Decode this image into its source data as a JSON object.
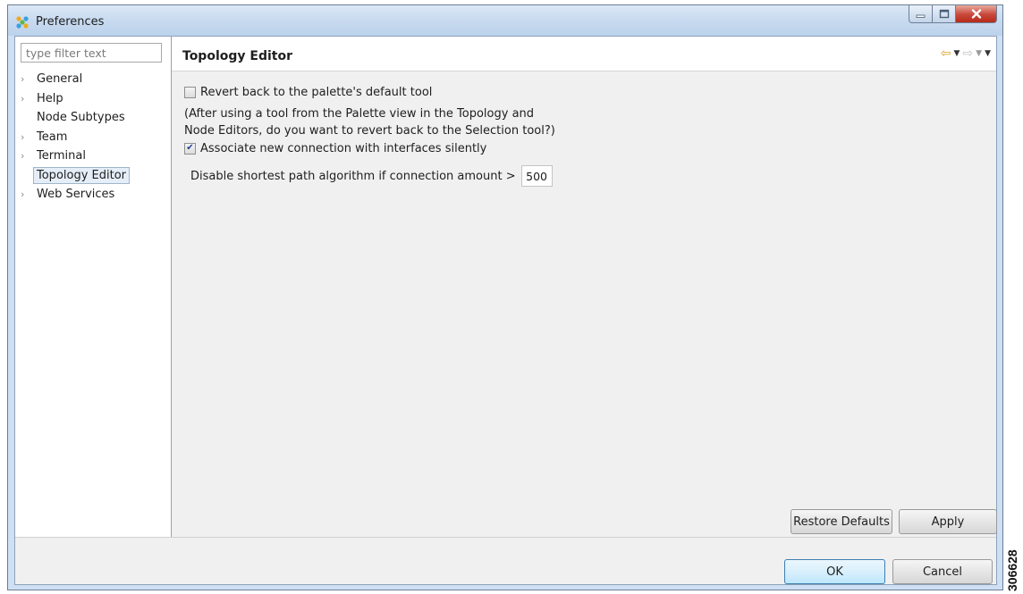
{
  "window": {
    "title": "Preferences",
    "icon": "eclipse-preferences-icon",
    "controls": [
      "minimize-icon",
      "maximize-icon",
      "close-icon"
    ]
  },
  "filter": {
    "placeholder": "type filter text",
    "value": ""
  },
  "tree": {
    "items": [
      {
        "label": "General",
        "expandable": true,
        "selected": false
      },
      {
        "label": "Help",
        "expandable": true,
        "selected": false
      },
      {
        "label": "Node Subtypes",
        "expandable": false,
        "selected": false
      },
      {
        "label": "Team",
        "expandable": true,
        "selected": false
      },
      {
        "label": "Terminal",
        "expandable": true,
        "selected": false
      },
      {
        "label": "Topology Editor",
        "expandable": false,
        "selected": true
      },
      {
        "label": "Web Services",
        "expandable": true,
        "selected": false
      }
    ]
  },
  "page": {
    "title": "Topology Editor",
    "revert_checkbox": {
      "label": "Revert back to the palette's default tool",
      "checked": false
    },
    "revert_note_line1": "(After using a tool from the Palette view in the Topology and",
    "revert_note_line2": "Node Editors, do you want to revert back to the Selection tool?)",
    "associate_checkbox": {
      "label": "Associate new connection with interfaces silently",
      "checked": true
    },
    "shortest_path": {
      "label": "Disable shortest path algorithm if connection amount >",
      "value": "500"
    },
    "restore_defaults_label": "Restore Defaults",
    "apply_label": "Apply"
  },
  "dialog_buttons": {
    "ok_label": "OK",
    "cancel_label": "Cancel"
  },
  "figure_id": "306628",
  "colors": {
    "accent_nav_back": "#e0a325",
    "selected_bg": "#e5eef8",
    "titlebar": "#c6d9ef"
  }
}
